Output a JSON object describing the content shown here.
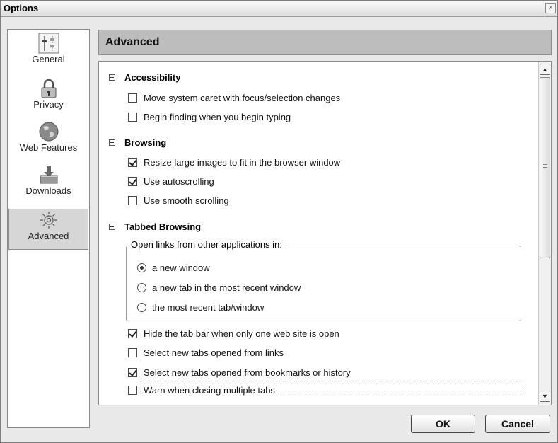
{
  "window": {
    "title": "Options",
    "close_glyph": "×"
  },
  "sidebar": {
    "items": [
      {
        "label": "General",
        "icon": "sliders-icon"
      },
      {
        "label": "Privacy",
        "icon": "lock-icon"
      },
      {
        "label": "Web Features",
        "icon": "globe-icon"
      },
      {
        "label": "Downloads",
        "icon": "download-tray-icon"
      },
      {
        "label": "Advanced",
        "icon": "gear-icon",
        "selected": true
      }
    ]
  },
  "header": {
    "title": "Advanced"
  },
  "sections": {
    "accessibility": {
      "title": "Accessibility",
      "items": [
        {
          "label": "Move system caret with focus/selection changes",
          "checked": false
        },
        {
          "label": "Begin finding when you begin typing",
          "checked": false
        }
      ]
    },
    "browsing": {
      "title": "Browsing",
      "items": [
        {
          "label": "Resize large images to fit in the browser window",
          "checked": true
        },
        {
          "label": "Use autoscrolling",
          "checked": true
        },
        {
          "label": "Use smooth scrolling",
          "checked": false
        }
      ]
    },
    "tabbed": {
      "title": "Tabbed Browsing",
      "group_label": "Open links from other applications in:",
      "radios": [
        {
          "label": "a new window",
          "selected": true
        },
        {
          "label": "a new tab in the most recent window",
          "selected": false
        },
        {
          "label": "the most recent tab/window",
          "selected": false
        }
      ],
      "items": [
        {
          "label": "Hide the tab bar when only one web site is open",
          "checked": true
        },
        {
          "label": "Select new tabs opened from links",
          "checked": false
        },
        {
          "label": "Select new tabs opened from bookmarks or history",
          "checked": true
        },
        {
          "label": "Warn when closing multiple tabs",
          "checked": false
        }
      ]
    }
  },
  "scrollbar": {
    "up_glyph": "▲",
    "down_glyph": "▼",
    "position_fraction": 0.0
  },
  "buttons": {
    "ok": "OK",
    "cancel": "Cancel"
  }
}
